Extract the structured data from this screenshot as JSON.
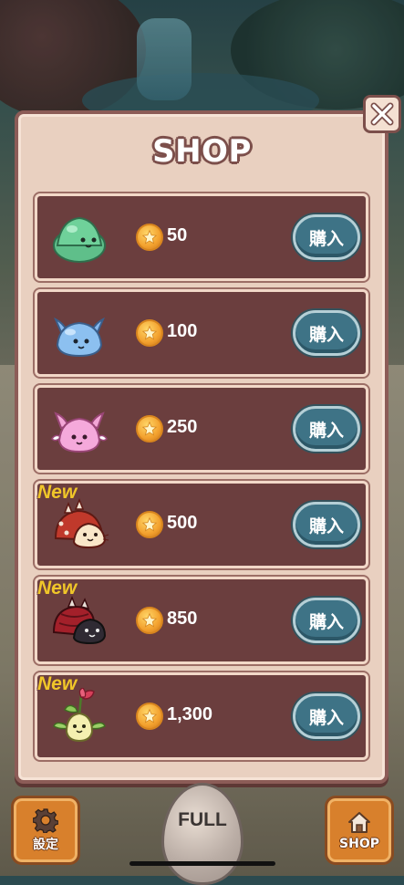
{
  "shop": {
    "title": "SHOP",
    "buy_label": "購入",
    "new_label": "New",
    "items": [
      {
        "pet": "green-slime-icon",
        "price": "50",
        "is_new": false
      },
      {
        "pet": "blue-slime-icon",
        "price": "100",
        "is_new": false
      },
      {
        "pet": "pink-slime-icon",
        "price": "250",
        "is_new": false
      },
      {
        "pet": "red-hood-cat-slime-icon",
        "price": "500",
        "is_new": true
      },
      {
        "pet": "dark-beetle-slime-icon",
        "price": "850",
        "is_new": true
      },
      {
        "pet": "flower-sprout-creature-icon",
        "price": "1,300",
        "is_new": true
      }
    ]
  },
  "bottom_bar": {
    "settings_label": "設定",
    "egg_label": "FULL",
    "shop_label": "SHOP"
  },
  "colors": {
    "panel_bg": "#e9d0c0",
    "row_bg": "#6b3e3e",
    "buy_button": "#3e7386",
    "new_tag": "#f0c629",
    "coin": "#f3a12e",
    "nav_button": "#d8802c"
  }
}
